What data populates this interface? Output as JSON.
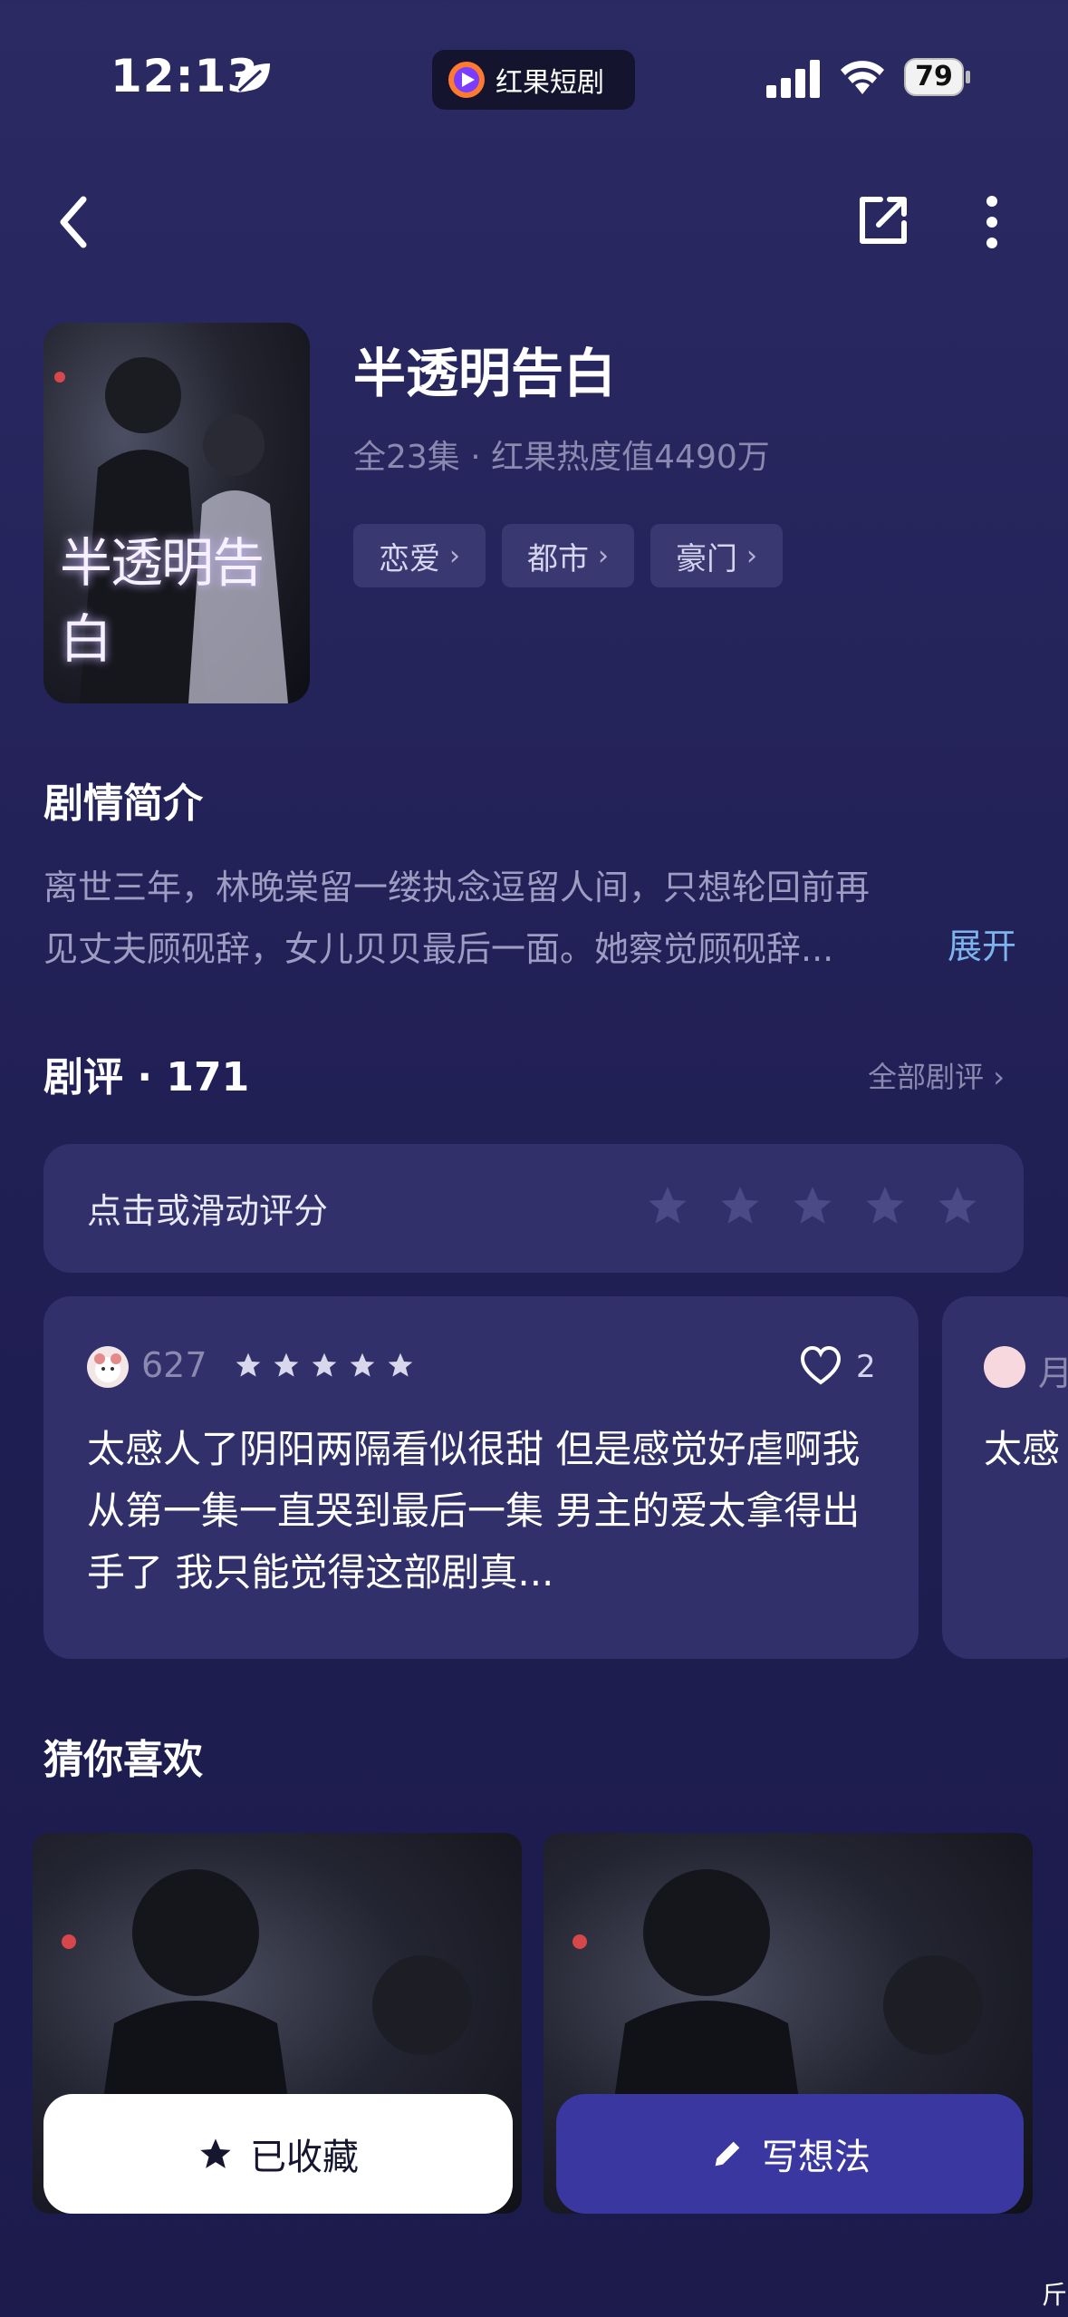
{
  "status_bar": {
    "time": "12:13",
    "app_pill": "红果短剧",
    "battery": "79"
  },
  "drama": {
    "title": "半透明告白",
    "poster_text": "半透明告白",
    "meta": "全23集 · 红果热度值4490万",
    "tags": [
      "恋爱",
      "都市",
      "豪门"
    ]
  },
  "synopsis": {
    "heading": "剧情简介",
    "text": "离世三年，林晚棠留一缕执念逗留人间，只想轮回前再见丈夫顾砚辞，女儿贝贝最后一面。她察觉顾砚辞...",
    "expand_label": "展开"
  },
  "reviews": {
    "heading": "剧评 · 171",
    "all_label": "全部剧评",
    "rate_prompt": "点击或滑动评分",
    "items": [
      {
        "user": "627",
        "stars": 5,
        "likes": "2",
        "text": "太感人了阴阳两隔看似很甜 但是感觉好虐啊我从第一集一直哭到最后一集 男主的爱太拿得出手了 我只能觉得这部剧真..."
      },
      {
        "user": "月",
        "text": "太感"
      }
    ]
  },
  "recommend": {
    "heading": "猜你喜欢"
  },
  "actions": {
    "favorite_label": "已收藏",
    "write_label": "写想法"
  },
  "corner_glyph": "斤",
  "colors": {
    "background": "#24235a",
    "card": "#31306a",
    "accent_link": "#7db4ee",
    "primary_button": "#3a37a0"
  }
}
